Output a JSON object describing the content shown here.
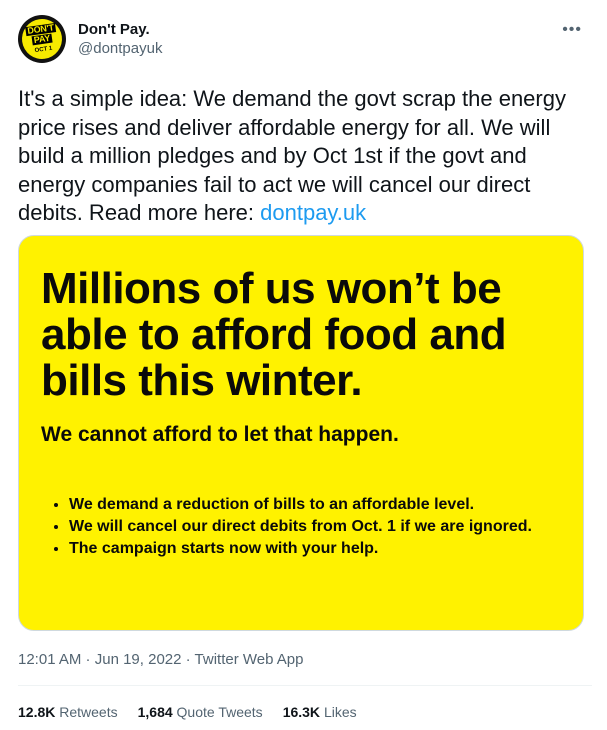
{
  "author": {
    "display_name": "Don't Pay.",
    "handle": "@dontpayuk",
    "avatar": {
      "line1": "DON'T",
      "line2": "PAY",
      "date": "OCT 1"
    }
  },
  "more_icon": "more-horizontal-icon",
  "tweet": {
    "text": "It's a simple idea: We demand the govt scrap the energy price rises and deliver affordable energy for all. We will build a million pledges and by Oct 1st if the govt and energy companies fail to act we will cancel our direct debits. Read more here: ",
    "link": "dontpay.uk"
  },
  "card": {
    "headline": "Millions of us won’t be able to afford food and bills this winter.",
    "subheadline": "We cannot afford to let that happen.",
    "bullets": [
      "We demand a reduction of bills to an affordable level.",
      "We will cancel our direct debits from Oct. 1 if we are ignored.",
      "The campaign starts now with your help."
    ]
  },
  "meta": {
    "time": "12:01 AM",
    "date": "Jun 19, 2022",
    "source": "Twitter Web App",
    "separator": " · "
  },
  "stats": {
    "retweets_count": "12.8K",
    "retweets_label": "Retweets",
    "quotes_count": "1,684",
    "quotes_label": "Quote Tweets",
    "likes_count": "16.3K",
    "likes_label": "Likes"
  },
  "colors": {
    "accent": "#1d9bf0",
    "card_background": "#fff200",
    "secondary_text": "#536471"
  }
}
